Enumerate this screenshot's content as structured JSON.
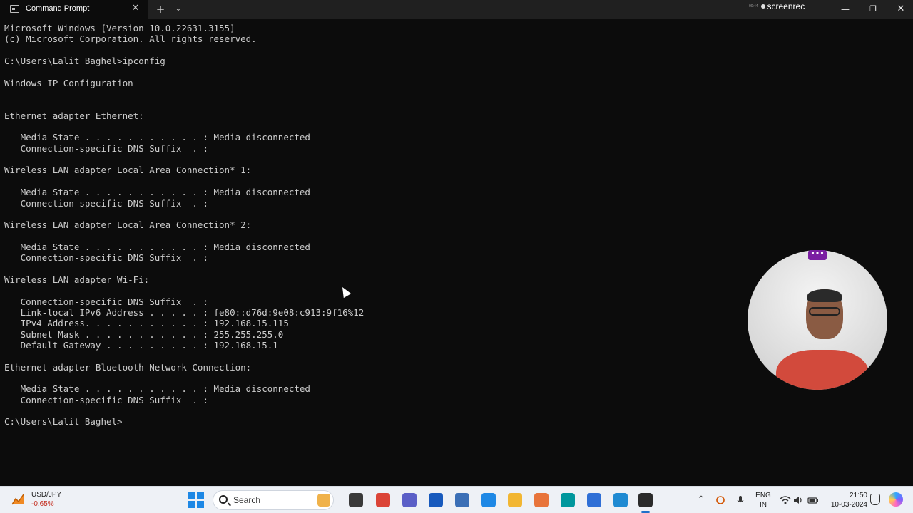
{
  "window": {
    "tab_title": "Command Prompt",
    "tab_close": "✕",
    "new_tab": "+",
    "dropdown": "⌄",
    "minimize": "—",
    "maximize": "❐",
    "close": "✕"
  },
  "overlay": {
    "screenrec_time": "00:44",
    "screenrec_brand": "screenrec",
    "cam_menu": "•••"
  },
  "console": {
    "lines": [
      "Microsoft Windows [Version 10.0.22631.3155]",
      "(c) Microsoft Corporation. All rights reserved.",
      "",
      "C:\\Users\\Lalit Baghel>ipconfig",
      "",
      "Windows IP Configuration",
      "",
      "",
      "Ethernet adapter Ethernet:",
      "",
      "   Media State . . . . . . . . . . . : Media disconnected",
      "   Connection-specific DNS Suffix  . :",
      "",
      "Wireless LAN adapter Local Area Connection* 1:",
      "",
      "   Media State . . . . . . . . . . . : Media disconnected",
      "   Connection-specific DNS Suffix  . :",
      "",
      "Wireless LAN adapter Local Area Connection* 2:",
      "",
      "   Media State . . . . . . . . . . . : Media disconnected",
      "   Connection-specific DNS Suffix  . :",
      "",
      "Wireless LAN adapter Wi-Fi:",
      "",
      "   Connection-specific DNS Suffix  . :",
      "   Link-local IPv6 Address . . . . . : fe80::d76d:9e08:c913:9f16%12",
      "   IPv4 Address. . . . . . . . . . . : 192.168.15.115",
      "   Subnet Mask . . . . . . . . . . . : 255.255.255.0",
      "   Default Gateway . . . . . . . . . : 192.168.15.1",
      "",
      "Ethernet adapter Bluetooth Network Connection:",
      "",
      "   Media State . . . . . . . . . . . : Media disconnected",
      "   Connection-specific DNS Suffix  . :",
      ""
    ],
    "prompt": "C:\\Users\\Lalit Baghel>"
  },
  "taskbar": {
    "widget_symbol": "USD/JPY",
    "widget_change": "-0.65%",
    "search_label": "Search",
    "tray_overflow": "^",
    "lang_line1": "ENG",
    "lang_line2": "IN",
    "clock_time": "21:50",
    "clock_date": "10-03-2024",
    "app_icons": [
      {
        "name": "task-view-icon",
        "color": "#3a3a3a"
      },
      {
        "name": "chrome-icon",
        "color": "#db4437"
      },
      {
        "name": "teams-icon",
        "color": "#5b5fc7"
      },
      {
        "name": "word-icon",
        "color": "#185abd"
      },
      {
        "name": "app-icon-1",
        "color": "#3b6fb6"
      },
      {
        "name": "app-icon-2",
        "color": "#1e88e5"
      },
      {
        "name": "file-explorer-icon",
        "color": "#f2b632"
      },
      {
        "name": "app-icon-3",
        "color": "#e8743b"
      },
      {
        "name": "arduino-icon",
        "color": "#00979d"
      },
      {
        "name": "app-icon-4",
        "color": "#2f6fd6"
      },
      {
        "name": "vscode-icon",
        "color": "#1f8ad2"
      },
      {
        "name": "terminal-icon",
        "color": "#2b2b2b"
      }
    ]
  },
  "colors": {
    "console_bg": "#0c0c0c",
    "console_text": "#cccccc",
    "titlebar_bg": "#202020",
    "taskbar_bg": "#eef1f6"
  }
}
